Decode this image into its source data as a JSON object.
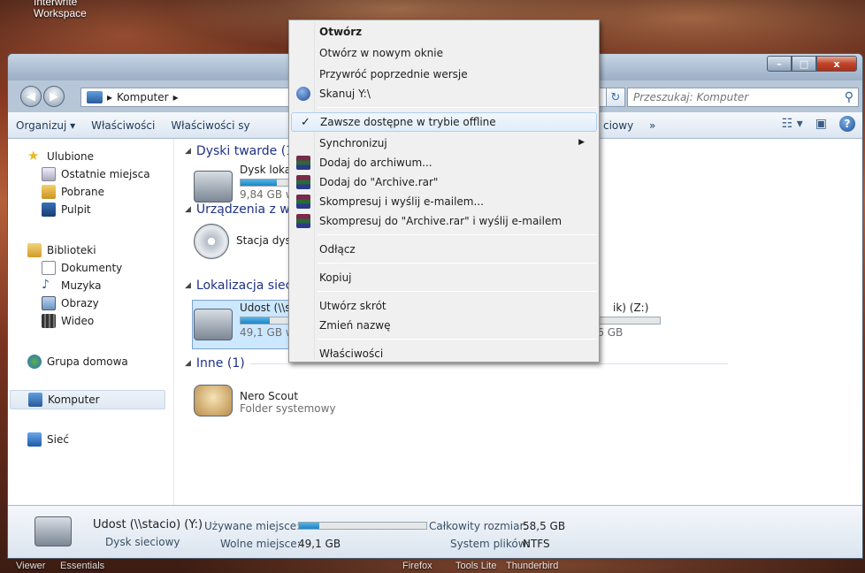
{
  "desktop": {
    "icon_label": "Interwrite\nWorkspace",
    "taskbar": [
      "Viewer",
      "Essentials",
      "Firefox",
      "Tools Lite",
      "Thunderbird"
    ]
  },
  "window": {
    "controls": {
      "minimize": "–",
      "maximize": "□",
      "close": "x"
    },
    "nav": {
      "back": "◀",
      "forward": "▶"
    },
    "address": {
      "path": [
        "Komputer"
      ]
    },
    "search": {
      "placeholder": "Przeszukaj: Komputer"
    },
    "toolbar": {
      "items": [
        "Organizuj ▾",
        "Właściwości",
        "Właściwości sy",
        "ciowy",
        "»"
      ]
    },
    "nav_pane": {
      "favorites": "Ulubione",
      "fav_items": [
        "Ostatnie miejsca",
        "Pobrane",
        "Pulpit"
      ],
      "libraries": "Biblioteki",
      "lib_items": [
        "Dokumenty",
        "Muzyka",
        "Obrazy",
        "Wideo"
      ],
      "homegroup": "Grupa domowa",
      "computer": "Komputer",
      "network": "Sieć"
    },
    "groups": {
      "hard_drives": "Dyski twarde (1",
      "removable": "Urządzenia z w",
      "network": "Lokalizacja siec",
      "other": "Inne (1)"
    },
    "drives": {
      "local": {
        "name": "Dysk loka",
        "free": "9,84 GB w",
        "used_fraction": 0.7
      },
      "dvd": {
        "name": "Stacja dys"
      },
      "udost": {
        "name": "Udost (\\\\s",
        "free": "49,1 GB wolnych z 58,5 GB",
        "used_fraction": 0.16
      },
      "z": {
        "name": "ik) (Z:)",
        "free": "2,58 GB wolnych z 7,46 GB",
        "used_fraction": 0.65
      },
      "nero": {
        "name": "Nero Scout",
        "sub": "Folder systemowy"
      }
    },
    "details": {
      "title": "Udost (\\\\stacio) (Y:)",
      "type": "Dysk sieciowy",
      "used_label": "Używane miejsce:",
      "free_label": "Wolne miejsce:",
      "free_value": "49,1 GB",
      "total_label": "Całkowity rozmiar:",
      "total_value": "58,5 GB",
      "fs_label": "System plików:",
      "fs_value": "NTFS",
      "used_fraction": 0.16
    }
  },
  "context_menu": {
    "open": "Otwórz",
    "open_new": "Otwórz w nowym oknie",
    "restore": "Przywróć poprzednie wersje",
    "scan": "Skanuj Y:\\",
    "offline": "Zawsze dostępne w trybie offline",
    "sync": "Synchronizuj",
    "add_archive": "Dodaj do archiwum...",
    "add_rar": "Dodaj do \"Archive.rar\"",
    "compress_email": "Skompresuj i wyślij e-mailem...",
    "compress_rar_email": "Skompresuj do \"Archive.rar\" i wyślij e-mailem",
    "disconnect": "Odłącz",
    "copy": "Kopiuj",
    "shortcut": "Utwórz skrót",
    "rename": "Zmień nazwę",
    "properties": "Właściwości"
  }
}
